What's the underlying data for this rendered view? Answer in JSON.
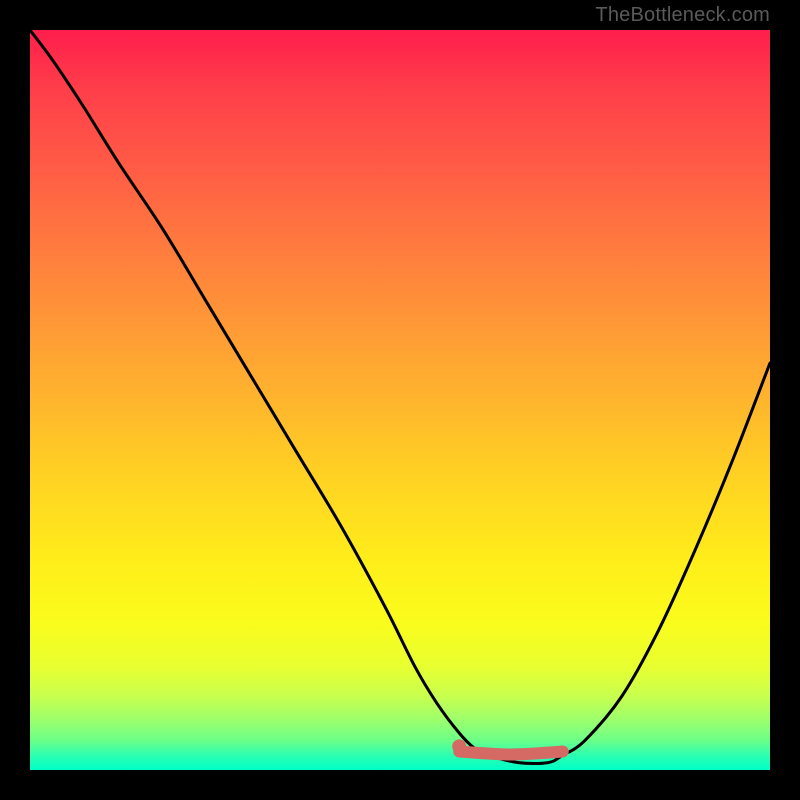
{
  "watermark": "TheBottleneck.com",
  "colors": {
    "curve": "#000000",
    "marker": "#d46a63",
    "background_top": "#ff1e4c",
    "background_bottom": "#00ffc8",
    "frame": "#000000"
  },
  "chart_data": {
    "type": "line",
    "title": "",
    "xlabel": "",
    "ylabel": "",
    "xlim": [
      0,
      100
    ],
    "ylim": [
      0,
      100
    ],
    "grid": false,
    "legend": false,
    "annotations": [],
    "series": [
      {
        "name": "bottleneck-curve",
        "x": [
          0,
          3,
          7,
          12,
          18,
          24,
          30,
          36,
          42,
          48,
          52,
          55,
          58,
          60,
          62,
          66,
          70,
          72,
          75,
          80,
          85,
          90,
          95,
          100
        ],
        "y": [
          100,
          96,
          90,
          82,
          73,
          63,
          53,
          43,
          33,
          22,
          14,
          9,
          5,
          3,
          2,
          1,
          1,
          2,
          4,
          10,
          19,
          30,
          42,
          55
        ]
      }
    ],
    "highlight_region": {
      "name": "optimal-range",
      "x": [
        58,
        72
      ],
      "y": [
        2.5,
        2.5
      ]
    },
    "highlight_point": {
      "name": "optimal-point",
      "x": 58,
      "y": 3.2
    }
  }
}
